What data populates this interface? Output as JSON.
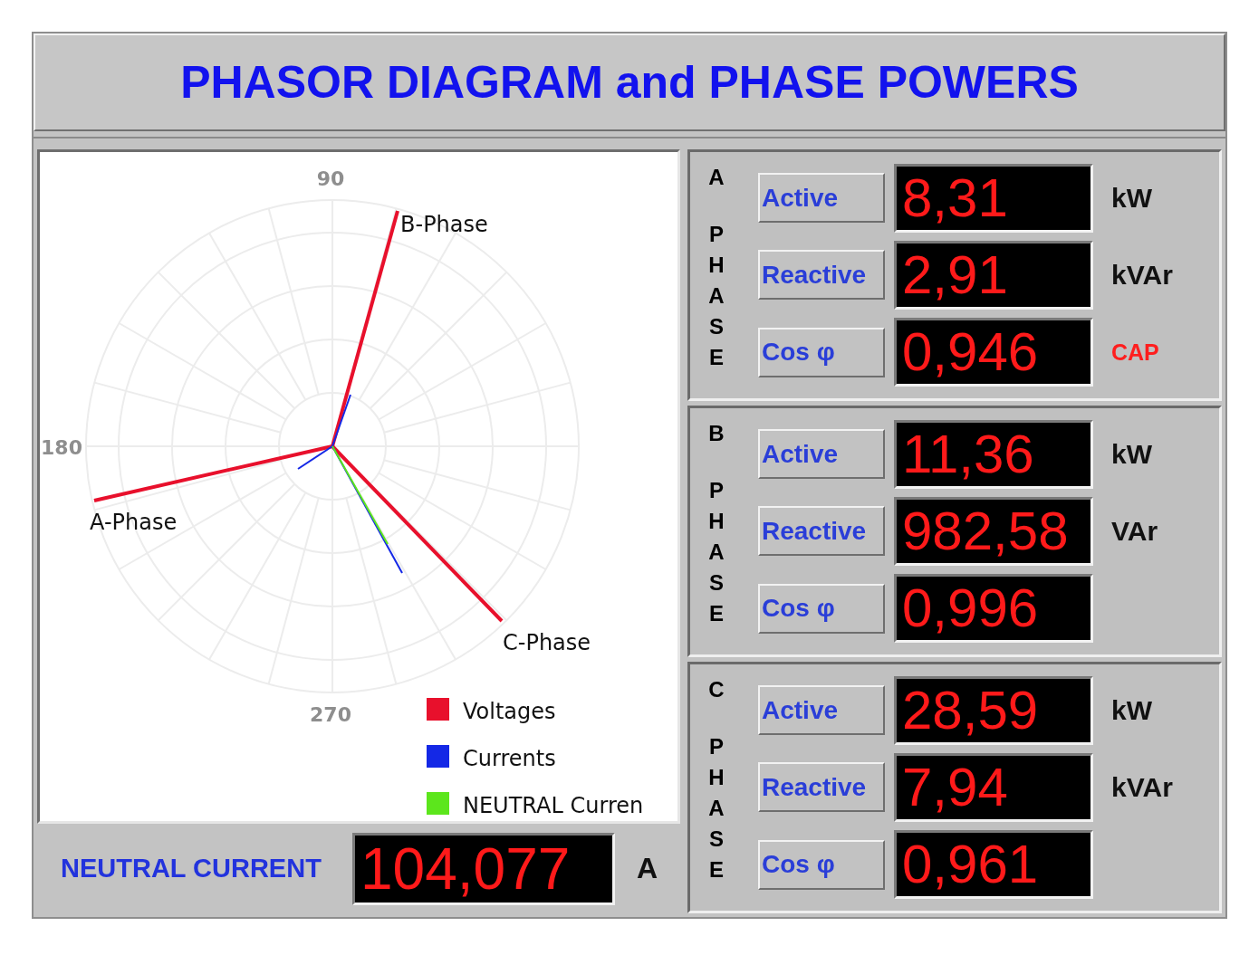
{
  "title": "PHASOR DIAGRAM and PHASE POWERS",
  "phasor_diagram": {
    "angle_labels": [
      "90",
      "180",
      "270"
    ],
    "phasor_labels": [
      "A-Phase",
      "B-Phase",
      "C-Phase"
    ],
    "legend": [
      {
        "label": "Voltages",
        "color": "#e8102c"
      },
      {
        "label": "Currents",
        "color": "#1428e6"
      },
      {
        "label": "NEUTRAL Curren",
        "color": "#5ce61c"
      }
    ]
  },
  "neutral_current": {
    "label": "NEUTRAL CURRENT",
    "value": "104,077",
    "unit": "A"
  },
  "phases": [
    {
      "letter": "A",
      "word": "PHASE",
      "rows": [
        {
          "kind": "power",
          "label": "Active",
          "value": "8,31",
          "unit": "kW"
        },
        {
          "kind": "power",
          "label": "Reactive",
          "value": "2,91",
          "unit": "kVAr"
        },
        {
          "kind": "power_factor",
          "label": "Cos φ",
          "value": "0,946",
          "mode": "CAP"
        }
      ]
    },
    {
      "letter": "B",
      "word": "PHASE",
      "rows": [
        {
          "kind": "power",
          "label": "Active",
          "value": "11,36",
          "unit": "kW"
        },
        {
          "kind": "power",
          "label": "Reactive",
          "value": "982,58",
          "unit": "VAr"
        },
        {
          "kind": "power_factor",
          "label": "Cos φ",
          "value": "0,996"
        }
      ]
    },
    {
      "letter": "C",
      "word": "PHASE",
      "rows": [
        {
          "kind": "power",
          "label": "Active",
          "value": "28,59",
          "unit": "kW"
        },
        {
          "kind": "power",
          "label": "Reactive",
          "value": "7,94",
          "unit": "kVAr"
        },
        {
          "kind": "power_factor",
          "label": "Cos φ",
          "value": "0,961"
        }
      ]
    }
  ]
}
